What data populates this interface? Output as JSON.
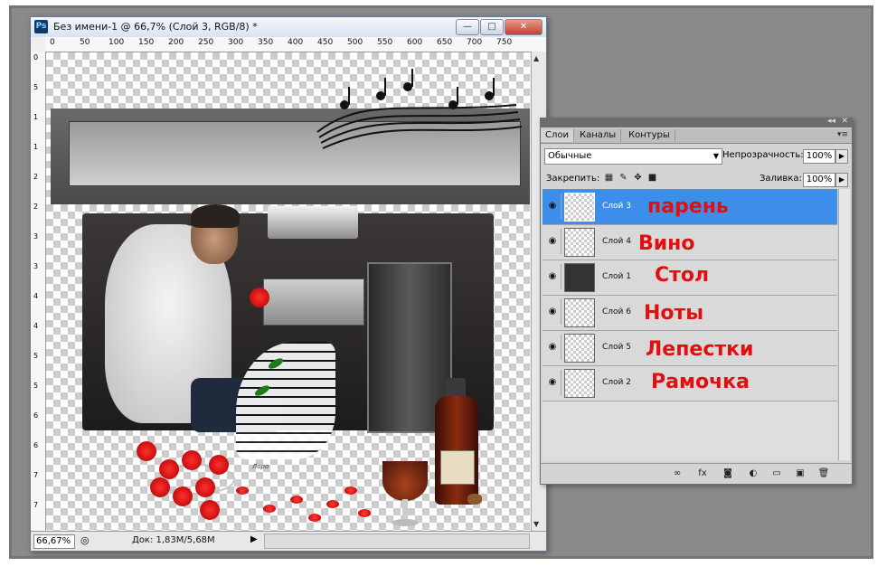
{
  "document": {
    "app_icon": "Ps",
    "title": "Без имени-1 @ 66,7% (Слой 3, RGB/8) *",
    "window_buttons": [
      "—",
      "□",
      "✕"
    ],
    "ruler_top_ticks": [
      "0",
      "50",
      "100",
      "150",
      "200",
      "250",
      "300",
      "350",
      "400",
      "450",
      "500",
      "550",
      "600",
      "650",
      "700",
      "750"
    ],
    "ruler_left_ticks": [
      "0",
      "5",
      "1",
      "1",
      "2",
      "2",
      "3",
      "3",
      "4",
      "4",
      "5",
      "5",
      "6",
      "6",
      "7",
      "7"
    ],
    "status": {
      "zoom": "66,67%",
      "doc_info": "Док: 1,83M/5,68M"
    },
    "canvas_watermark": "Лоро"
  },
  "layers_panel": {
    "tabs": [
      "Слои",
      "Каналы",
      "Контуры"
    ],
    "active_tab": "Слои",
    "blend_mode": "Обычные",
    "opacity_label": "Непрозрачность:",
    "opacity_value": "100%",
    "lock_label": "Закрепить:",
    "fill_label": "Заливка:",
    "fill_value": "100%",
    "layers": [
      {
        "name": "Слой 3",
        "annotation": "парень",
        "selected": true
      },
      {
        "name": "Слой 4",
        "annotation": "Вино",
        "selected": false
      },
      {
        "name": "Слой 1",
        "annotation": "Стол",
        "selected": false
      },
      {
        "name": "Слой 6",
        "annotation": "Ноты",
        "selected": false
      },
      {
        "name": "Слой 5",
        "annotation": "Лепестки",
        "selected": false
      },
      {
        "name": "Слой 2",
        "annotation": "Рамочка",
        "selected": false
      }
    ],
    "bottom_icons": [
      "link-icon",
      "fx-icon",
      "mask-icon",
      "adjustment-icon",
      "folder-icon",
      "new-layer-icon",
      "trash-icon"
    ]
  },
  "colors": {
    "selection": "#3d8ee8",
    "annotation": "#e01010",
    "backdrop": "#8a8a8a"
  }
}
